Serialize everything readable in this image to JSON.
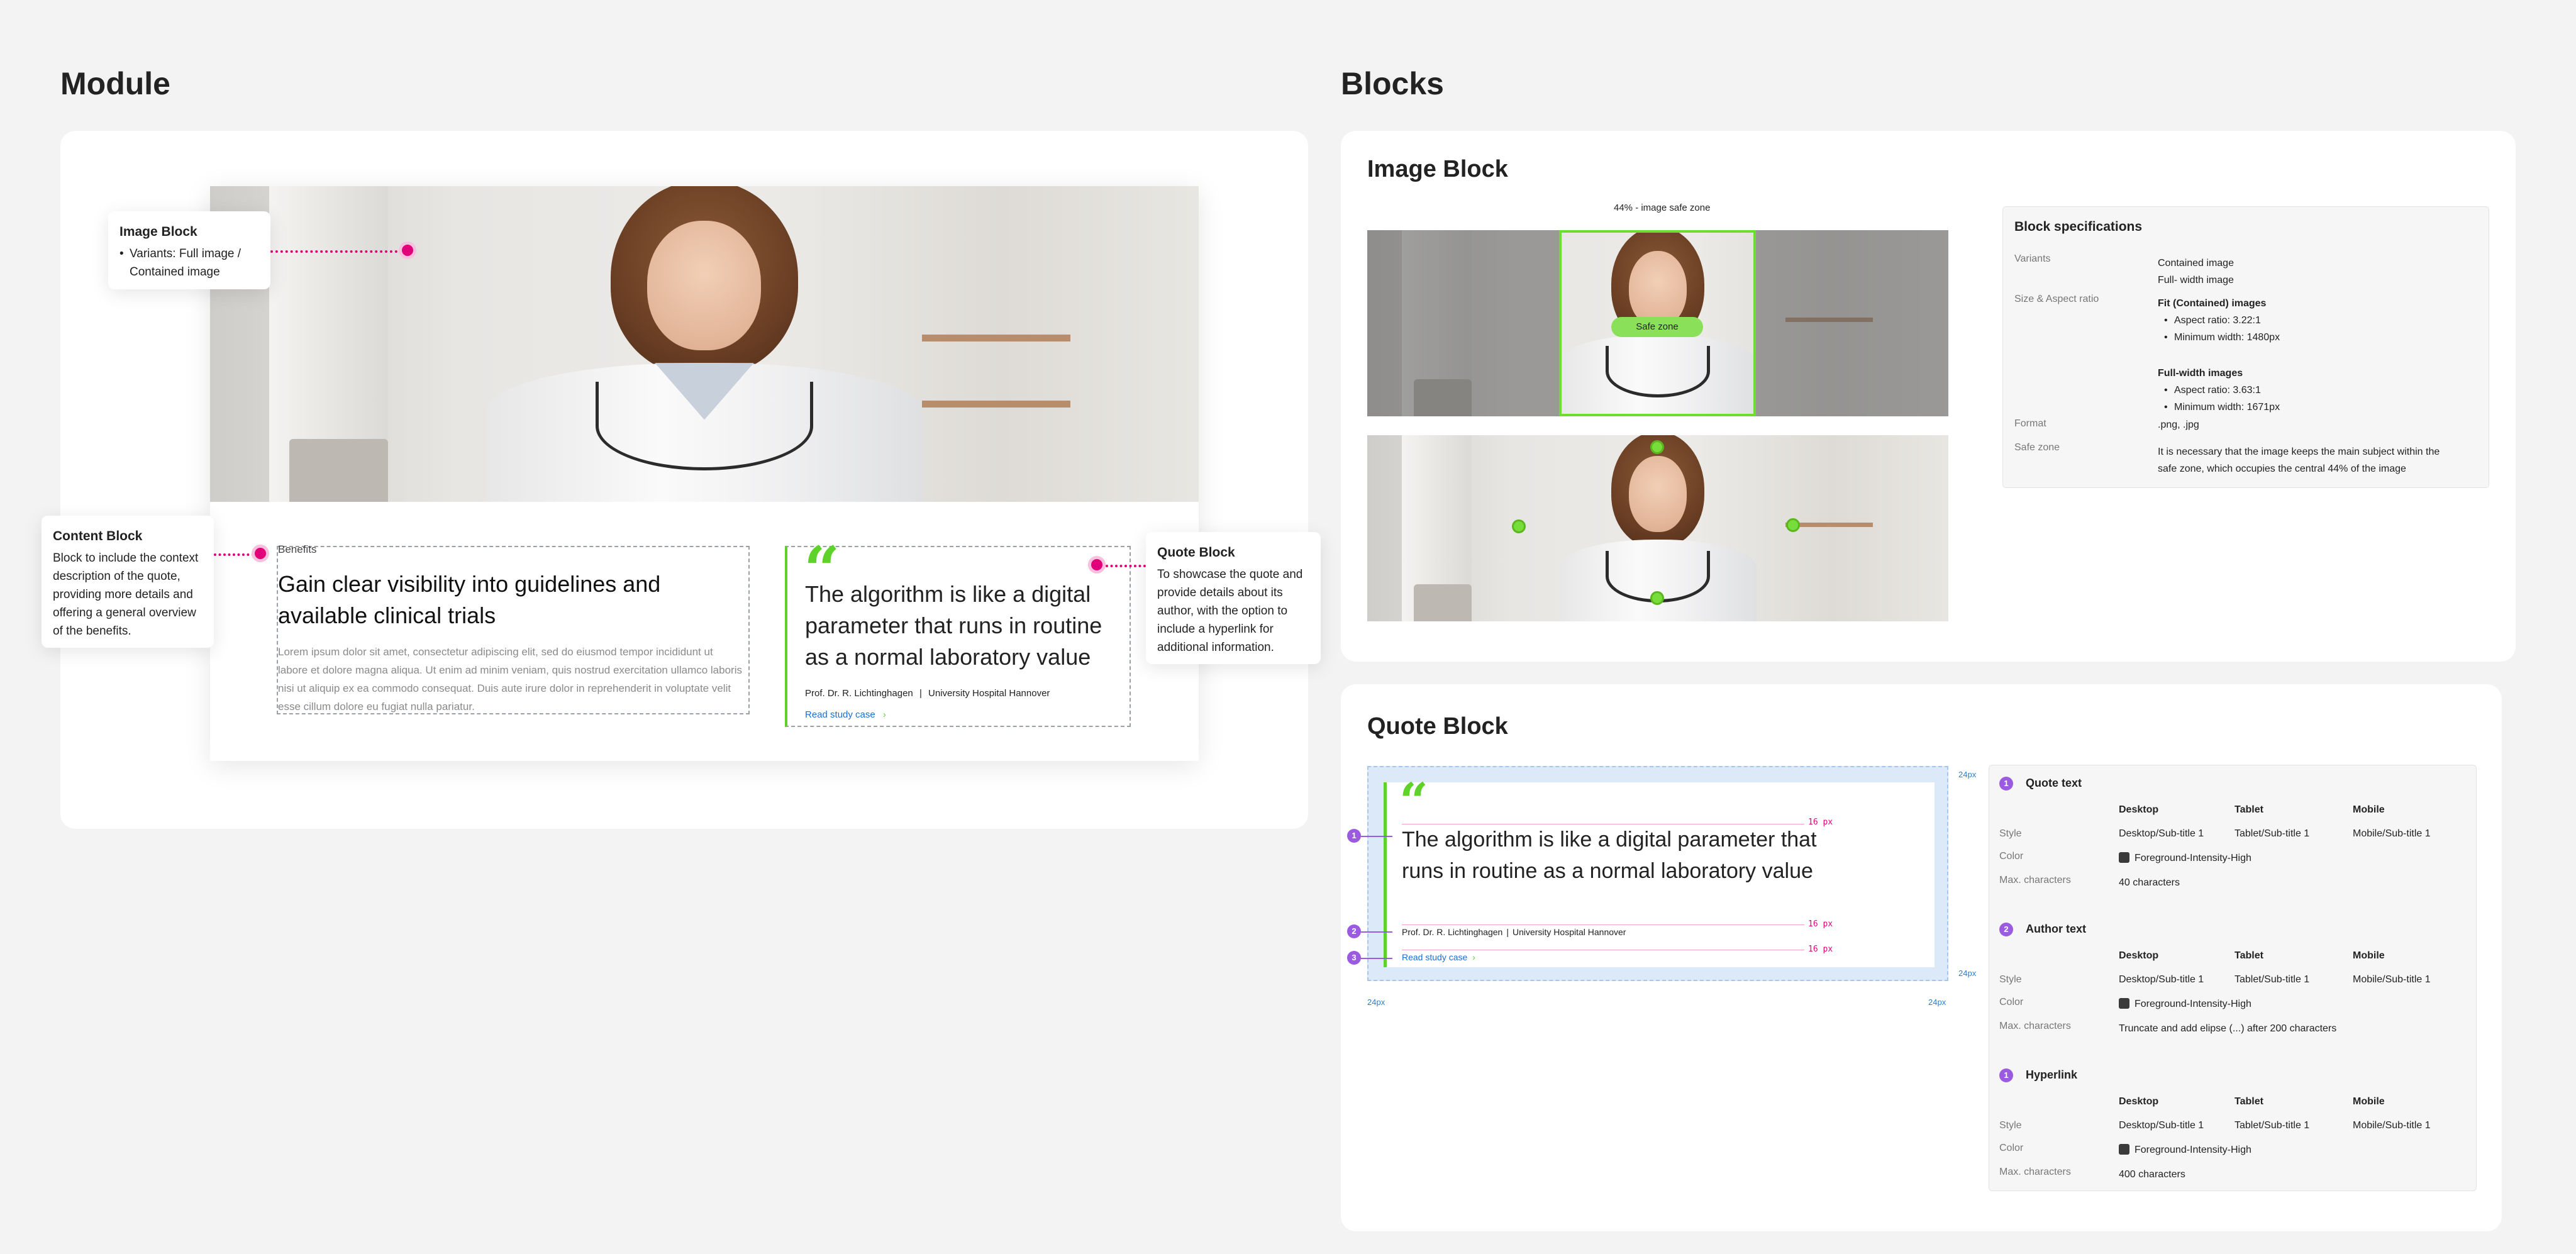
{
  "sections": {
    "module_title": "Module",
    "blocks_title": "Blocks"
  },
  "module": {
    "image_block_callout": {
      "title": "Image Block",
      "bullet": "Variants: Full image / Contained image"
    },
    "content_block_callout": {
      "title": "Content Block",
      "text": "Block to include the context description of the quote, providing more details and offering a general overview of the benefits."
    },
    "quote_block_callout": {
      "title": "Quote Block",
      "text": "To showcase the quote and provide details about its author, with the option to include a hyperlink for additional information."
    },
    "content": {
      "eyebrow": "Benefits",
      "headline": "Gain clear visibility into guidelines and available clinical trials",
      "body": "Lorem ipsum dolor sit amet, consectetur adipiscing elit, sed do eiusmod tempor incididunt ut labore et dolore magna aliqua. Ut enim ad minim veniam, quis nostrud exercitation ullamco laboris nisi ut aliquip ex ea commodo consequat. Duis aute irure dolor in reprehenderit in voluptate velit esse cillum dolore eu fugiat nulla pariatur."
    },
    "quote": {
      "mark": "“",
      "text": "The algorithm is like a digital parameter that runs in routine as a normal laboratory value",
      "author": "Prof. Dr. R. Lichtinghagen",
      "affiliation": "University Hospital Hannover",
      "link": "Read study case",
      "link_arrow": "›"
    }
  },
  "image_block": {
    "title": "Image Block",
    "safe_zone_caption": "44% - image safe zone",
    "safe_zone_label": "Safe zone",
    "spec": {
      "title": "Block specifications",
      "rows": [
        {
          "label": "Variants",
          "lines": [
            "Contained image",
            "Full- width image"
          ]
        },
        {
          "label": "Size & Aspect ratio",
          "lines": []
        },
        {
          "label": "Format",
          "lines": [
            ".png, .jpg"
          ]
        },
        {
          "label": "Safe zone",
          "lines": [
            "It is necessary that the image keeps the main subject within the",
            "safe zone, which occupies the central 44% of the image"
          ]
        }
      ],
      "fit_title": "Fit (Contained) images",
      "fit_items": [
        "Aspect ratio: 3.22:1",
        "Minimum width: 1480px"
      ],
      "full_title": "Full-width images",
      "full_items": [
        "Aspect ratio: 3.63:1",
        "Minimum width: 1671px"
      ]
    }
  },
  "quote_block": {
    "title": "Quote Block",
    "preview": {
      "quote": "The algorithm is like a digital parameter that runs in routine as a normal laboratory value",
      "author": "Prof. Dr. R. Lichtinghagen",
      "affiliation": "University Hospital Hannover",
      "link": "Read study case",
      "spacing_16": "16 px",
      "spacing_24": "24px",
      "markers": [
        "1",
        "2",
        "3"
      ]
    },
    "specs": [
      {
        "num": "1",
        "title": "Quote text",
        "cols": [
          "Desktop",
          "Tablet",
          "Mobile"
        ],
        "style_label": "Style",
        "styles": [
          "Desktop/Sub-title 1",
          "Tablet/Sub-title 1",
          "Mobile/Sub-title 1"
        ],
        "color_label": "Color",
        "color": "Foreground-Intensity-High",
        "max_label": "Max. characters",
        "max": "40 characters"
      },
      {
        "num": "2",
        "title": "Author text",
        "cols": [
          "Desktop",
          "Tablet",
          "Mobile"
        ],
        "style_label": "Style",
        "styles": [
          "Desktop/Sub-title 1",
          "Tablet/Sub-title 1",
          "Mobile/Sub-title 1"
        ],
        "color_label": "Color",
        "color": "Foreground-Intensity-High",
        "max_label": "Max. characters",
        "max": "Truncate and add elipse (...) after 200 characters"
      },
      {
        "num": "1",
        "title": "Hyperlink",
        "cols": [
          "Desktop",
          "Tablet",
          "Mobile"
        ],
        "style_label": "Style",
        "styles": [
          "Desktop/Sub-title 1",
          "Tablet/Sub-title 1",
          "Mobile/Sub-title 1"
        ],
        "color_label": "Color",
        "color": "Foreground-Intensity-High",
        "max_label": "Max. characters",
        "max": "400 characters"
      }
    ]
  },
  "colors": {
    "accent_green": "#5fd22a",
    "pin_magenta": "#e2007a",
    "marker_purple": "#9a5be0",
    "link_blue": "#1a6fd1"
  }
}
